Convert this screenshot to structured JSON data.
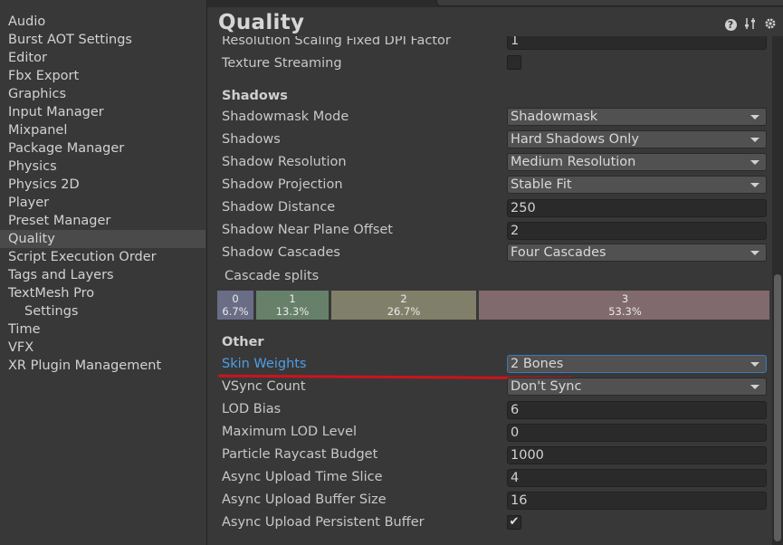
{
  "sidebar": {
    "items": [
      {
        "label": "Audio"
      },
      {
        "label": "Burst AOT Settings"
      },
      {
        "label": "Editor"
      },
      {
        "label": "Fbx Export"
      },
      {
        "label": "Graphics"
      },
      {
        "label": "Input Manager"
      },
      {
        "label": "Mixpanel"
      },
      {
        "label": "Package Manager"
      },
      {
        "label": "Physics"
      },
      {
        "label": "Physics 2D"
      },
      {
        "label": "Player"
      },
      {
        "label": "Preset Manager"
      },
      {
        "label": "Quality",
        "selected": true
      },
      {
        "label": "Script Execution Order"
      },
      {
        "label": "Tags and Layers"
      },
      {
        "label": "TextMesh Pro"
      },
      {
        "label": "Settings",
        "indent": true
      },
      {
        "label": "Time"
      },
      {
        "label": "VFX"
      },
      {
        "label": "XR Plugin Management"
      }
    ]
  },
  "header": {
    "title": "Quality",
    "icons": [
      "help-icon",
      "preset-icon",
      "gear-icon"
    ]
  },
  "rows": {
    "resolution_scaling": {
      "label": "Resolution Scaling Fixed DPI Factor",
      "value": "1"
    },
    "texture_streaming": {
      "label": "Texture Streaming",
      "checked": false
    },
    "shadows_header": "Shadows",
    "shadowmask_mode": {
      "label": "Shadowmask Mode",
      "value": "Shadowmask"
    },
    "shadows": {
      "label": "Shadows",
      "value": "Hard Shadows Only"
    },
    "shadow_resolution": {
      "label": "Shadow Resolution",
      "value": "Medium Resolution"
    },
    "shadow_projection": {
      "label": "Shadow Projection",
      "value": "Stable Fit"
    },
    "shadow_distance": {
      "label": "Shadow Distance",
      "value": "250"
    },
    "shadow_near_plane": {
      "label": "Shadow Near Plane Offset",
      "value": "2"
    },
    "shadow_cascades": {
      "label": "Shadow Cascades",
      "value": "Four Cascades"
    },
    "cascade_splits_label": "Cascade splits",
    "other_header": "Other",
    "skin_weights": {
      "label": "Skin Weights",
      "value": "2 Bones"
    },
    "vsync_count": {
      "label": "VSync Count",
      "value": "Don't Sync"
    },
    "lod_bias": {
      "label": "LOD Bias",
      "value": "6"
    },
    "max_lod_level": {
      "label": "Maximum LOD Level",
      "value": "0"
    },
    "particle_raycast": {
      "label": "Particle Raycast Budget",
      "value": "1000"
    },
    "async_time_slice": {
      "label": "Async Upload Time Slice",
      "value": "4"
    },
    "async_buffer_size": {
      "label": "Async Upload Buffer Size",
      "value": "16"
    },
    "async_persistent": {
      "label": "Async Upload Persistent Buffer",
      "checked": true
    }
  },
  "cascade_splits": [
    {
      "index": "0",
      "percent": "6.7%",
      "fraction": 0.067,
      "color": "#6a6d86"
    },
    {
      "index": "1",
      "percent": "13.3%",
      "fraction": 0.133,
      "color": "#67806a"
    },
    {
      "index": "2",
      "percent": "26.7%",
      "fraction": 0.267,
      "color": "#80806a"
    },
    {
      "index": "3",
      "percent": "53.3%",
      "fraction": 0.533,
      "color": "#806a6d"
    }
  ],
  "colors": {
    "background": "#383838",
    "link": "#4f9ee8",
    "annotation_underline": "#d0121b",
    "selected_item": "#4a4a4a"
  }
}
